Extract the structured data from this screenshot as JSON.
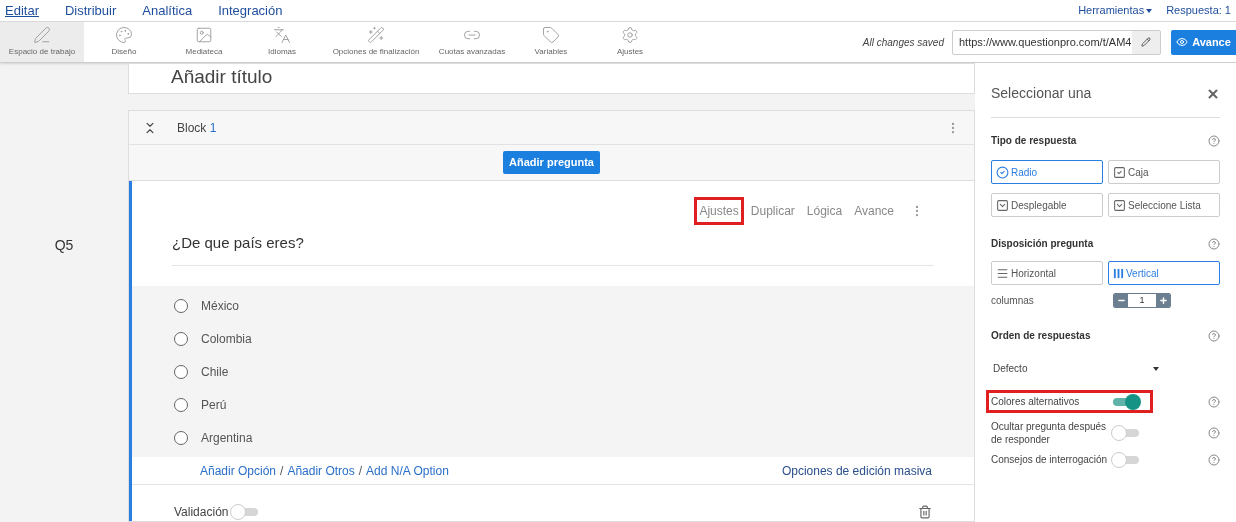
{
  "nav": {
    "tabs": [
      {
        "label": "Editar",
        "selected": true
      },
      {
        "label": "Distribuir",
        "selected": false
      },
      {
        "label": "Analítica",
        "selected": false
      },
      {
        "label": "Integración",
        "selected": false
      }
    ],
    "tools_menu": "Herramientas",
    "responses": "Respuesta: 1"
  },
  "toolbar": {
    "items": [
      {
        "kind": "workspace",
        "label": "Espacio de trabajo",
        "selected": true
      },
      {
        "kind": "design",
        "label": "Diseño",
        "selected": false
      },
      {
        "kind": "media",
        "label": "Mediateca",
        "selected": false
      },
      {
        "kind": "languages",
        "label": "Idiomas",
        "selected": false
      },
      {
        "kind": "finish",
        "label": "Opciones de finalización",
        "selected": false
      },
      {
        "kind": "quotas",
        "label": "Cuotas avanzadas",
        "selected": false
      },
      {
        "kind": "variables",
        "label": "Variables",
        "selected": false
      },
      {
        "kind": "settings",
        "label": "Ajustes",
        "selected": false
      }
    ],
    "save_status": "All changes saved",
    "url": "https://www.questionpro.com/t/AM4",
    "preview_button": "Avance"
  },
  "survey": {
    "title": "Añadir título",
    "block": {
      "name": "Block",
      "number": "1"
    },
    "add_question": "Añadir pregunta"
  },
  "question": {
    "number": "Q5",
    "text": "¿De que país eres?",
    "actions": [
      {
        "label": "Ajustes",
        "highlighted": true
      },
      {
        "label": "Duplicar",
        "highlighted": false
      },
      {
        "label": "Lógica",
        "highlighted": false
      },
      {
        "label": "Avance",
        "highlighted": false
      }
    ],
    "options": [
      {
        "label": "México",
        "selected": false
      },
      {
        "label": "Colombia",
        "selected": false
      },
      {
        "label": "Chile",
        "selected": false
      },
      {
        "label": "Perú",
        "selected": false
      },
      {
        "label": "Argentina",
        "selected": false
      }
    ],
    "add_links": [
      "Añadir Opción",
      "Añadir Otros",
      "Add N/A Option"
    ],
    "separator": "/",
    "bulk_edit": "Opciones de edición masiva",
    "validation": {
      "label": "Validación",
      "on": false
    }
  },
  "panel": {
    "title": "Seleccionar una",
    "answer_type": {
      "heading": "Tipo de respuesta",
      "options": [
        {
          "kind": "radio",
          "label": "Radio",
          "selected": true
        },
        {
          "kind": "checkbox",
          "label": "Caja",
          "selected": false
        },
        {
          "kind": "dropdown",
          "label": "Desplegable",
          "selected": false
        },
        {
          "kind": "dropdown",
          "label": "Seleccione Lista",
          "selected": false
        }
      ]
    },
    "layout": {
      "heading": "Disposición pregunta",
      "options": [
        {
          "kind": "horizontal",
          "label": "Horizontal",
          "selected": false
        },
        {
          "kind": "vertical",
          "label": "Vertical",
          "selected": true
        }
      ],
      "columns_label": "columnas",
      "columns": "1"
    },
    "order": {
      "heading": "Orden de respuestas",
      "value": "Defecto"
    },
    "toggles": [
      {
        "label": "Colores alternativos",
        "on": true,
        "highlighted": true
      },
      {
        "label": "Ocultar pregunta después de responder",
        "on": false,
        "highlighted": false
      },
      {
        "label": "Consejos de interrogación",
        "on": false,
        "highlighted": false
      }
    ]
  }
}
